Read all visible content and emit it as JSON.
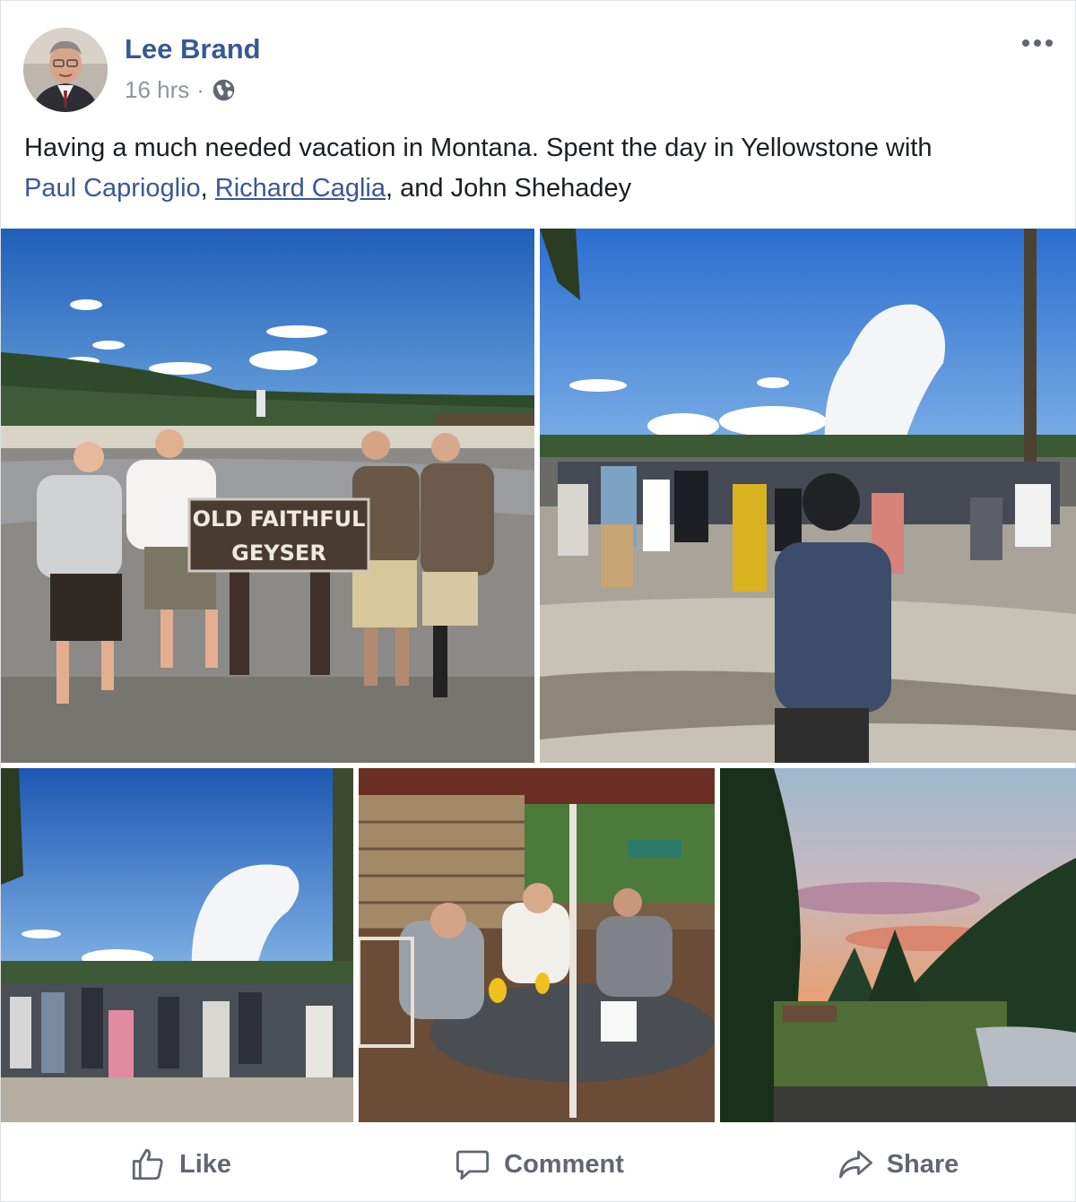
{
  "post": {
    "author": "Lee Brand",
    "time": "16 hrs",
    "separator": "·",
    "privacy_icon": "globe-icon",
    "text_intro": "Having a much needed vacation in Montana. Spent the day in Yellowstone with",
    "tags": [
      "Paul Caprioglio",
      "Richard Caglia"
    ],
    "sep_comma_1": ", ",
    "sep_and": ", and ",
    "tag_last": "John Shehadey",
    "sign_line1": "OLD FAITHFUL",
    "sign_line2": "GEYSER"
  },
  "actions": {
    "like_label": "Like",
    "comment_label": "Comment",
    "share_label": "Share"
  },
  "colors": {
    "link": "#385898",
    "meta": "#90949c",
    "action": "#606770"
  }
}
